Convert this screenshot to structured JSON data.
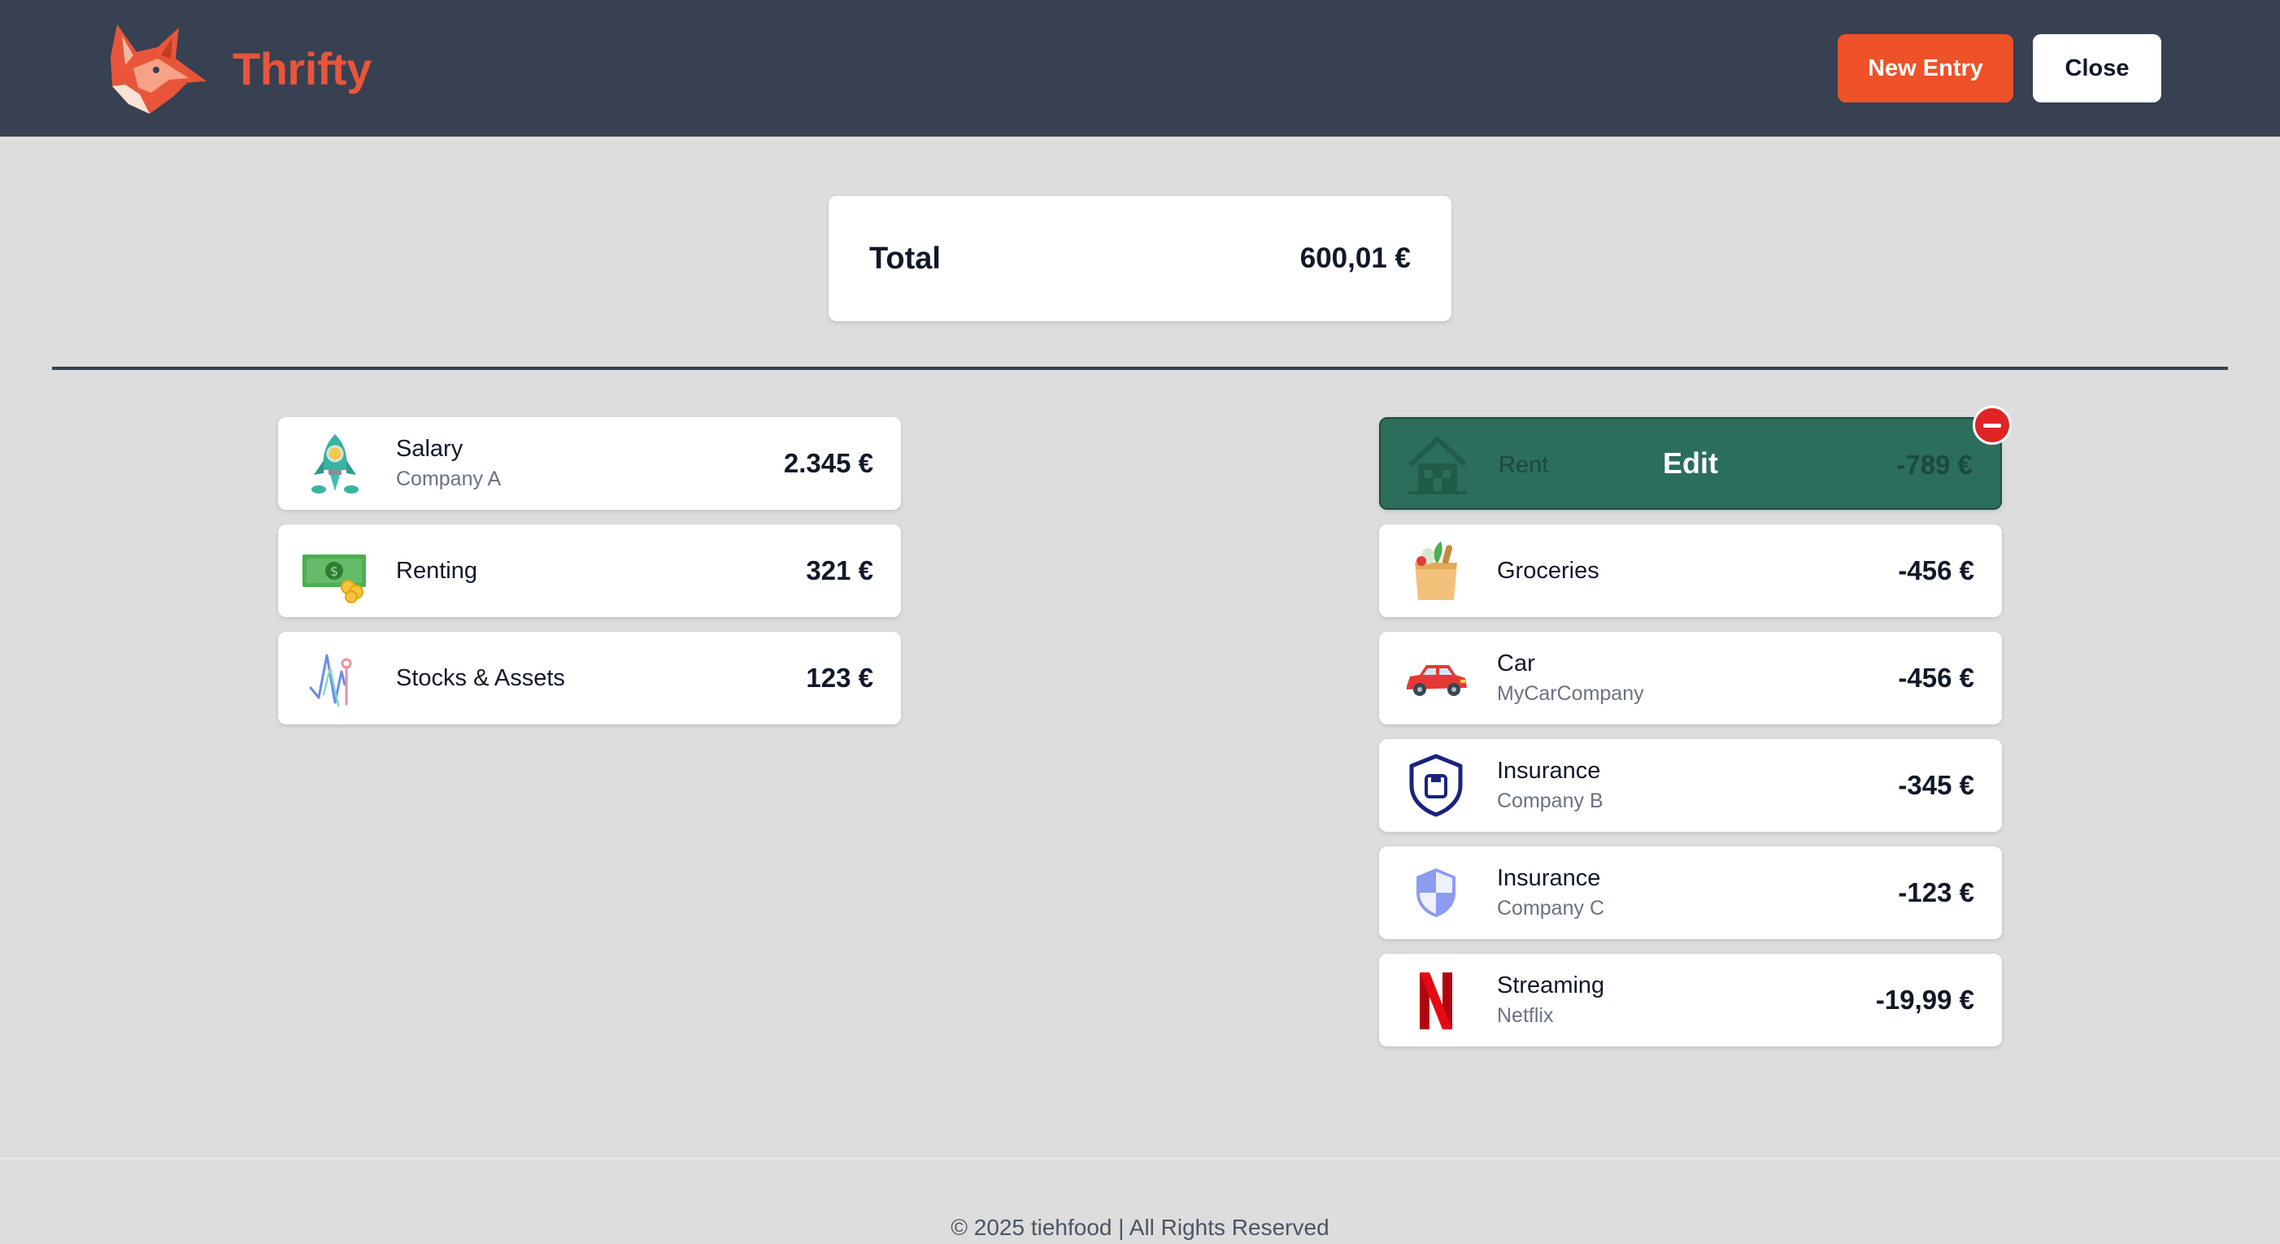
{
  "app": {
    "brand_name": "Thrifty",
    "logo_icon": "fox-logo-icon",
    "accent_color": "#ef5128"
  },
  "header": {
    "new_entry_label": "New Entry",
    "close_label": "Close"
  },
  "summary": {
    "label": "Total",
    "value": "600,01 €"
  },
  "income": [
    {
      "icon": "rocket-icon",
      "name": "Salary",
      "sub": "Company A",
      "amount": "2.345 €"
    },
    {
      "icon": "money-bill-icon",
      "name": "Renting",
      "sub": "",
      "amount": "321 €"
    },
    {
      "icon": "stock-chart-icon",
      "name": "Stocks & Assets",
      "sub": "",
      "amount": "123 €"
    }
  ],
  "expenses": [
    {
      "icon": "house-icon",
      "name": "Rent",
      "sub": "",
      "amount": "-789 €",
      "edit_label": "Edit",
      "state": "editing"
    },
    {
      "icon": "grocery-bag-icon",
      "name": "Groceries",
      "sub": "",
      "amount": "-456 €"
    },
    {
      "icon": "car-icon",
      "name": "Car",
      "sub": "MyCarCompany",
      "amount": "-456 €"
    },
    {
      "icon": "shield-icon",
      "name": "Insurance",
      "sub": "Company B",
      "amount": "-345 €"
    },
    {
      "icon": "shield-half-icon",
      "name": "Insurance",
      "sub": "Company C",
      "amount": "-123 €"
    },
    {
      "icon": "netflix-icon",
      "name": "Streaming",
      "sub": "Netflix",
      "amount": "-19,99 €"
    }
  ],
  "footer": {
    "text": "© 2025 tiehfood | All Rights Reserved"
  }
}
